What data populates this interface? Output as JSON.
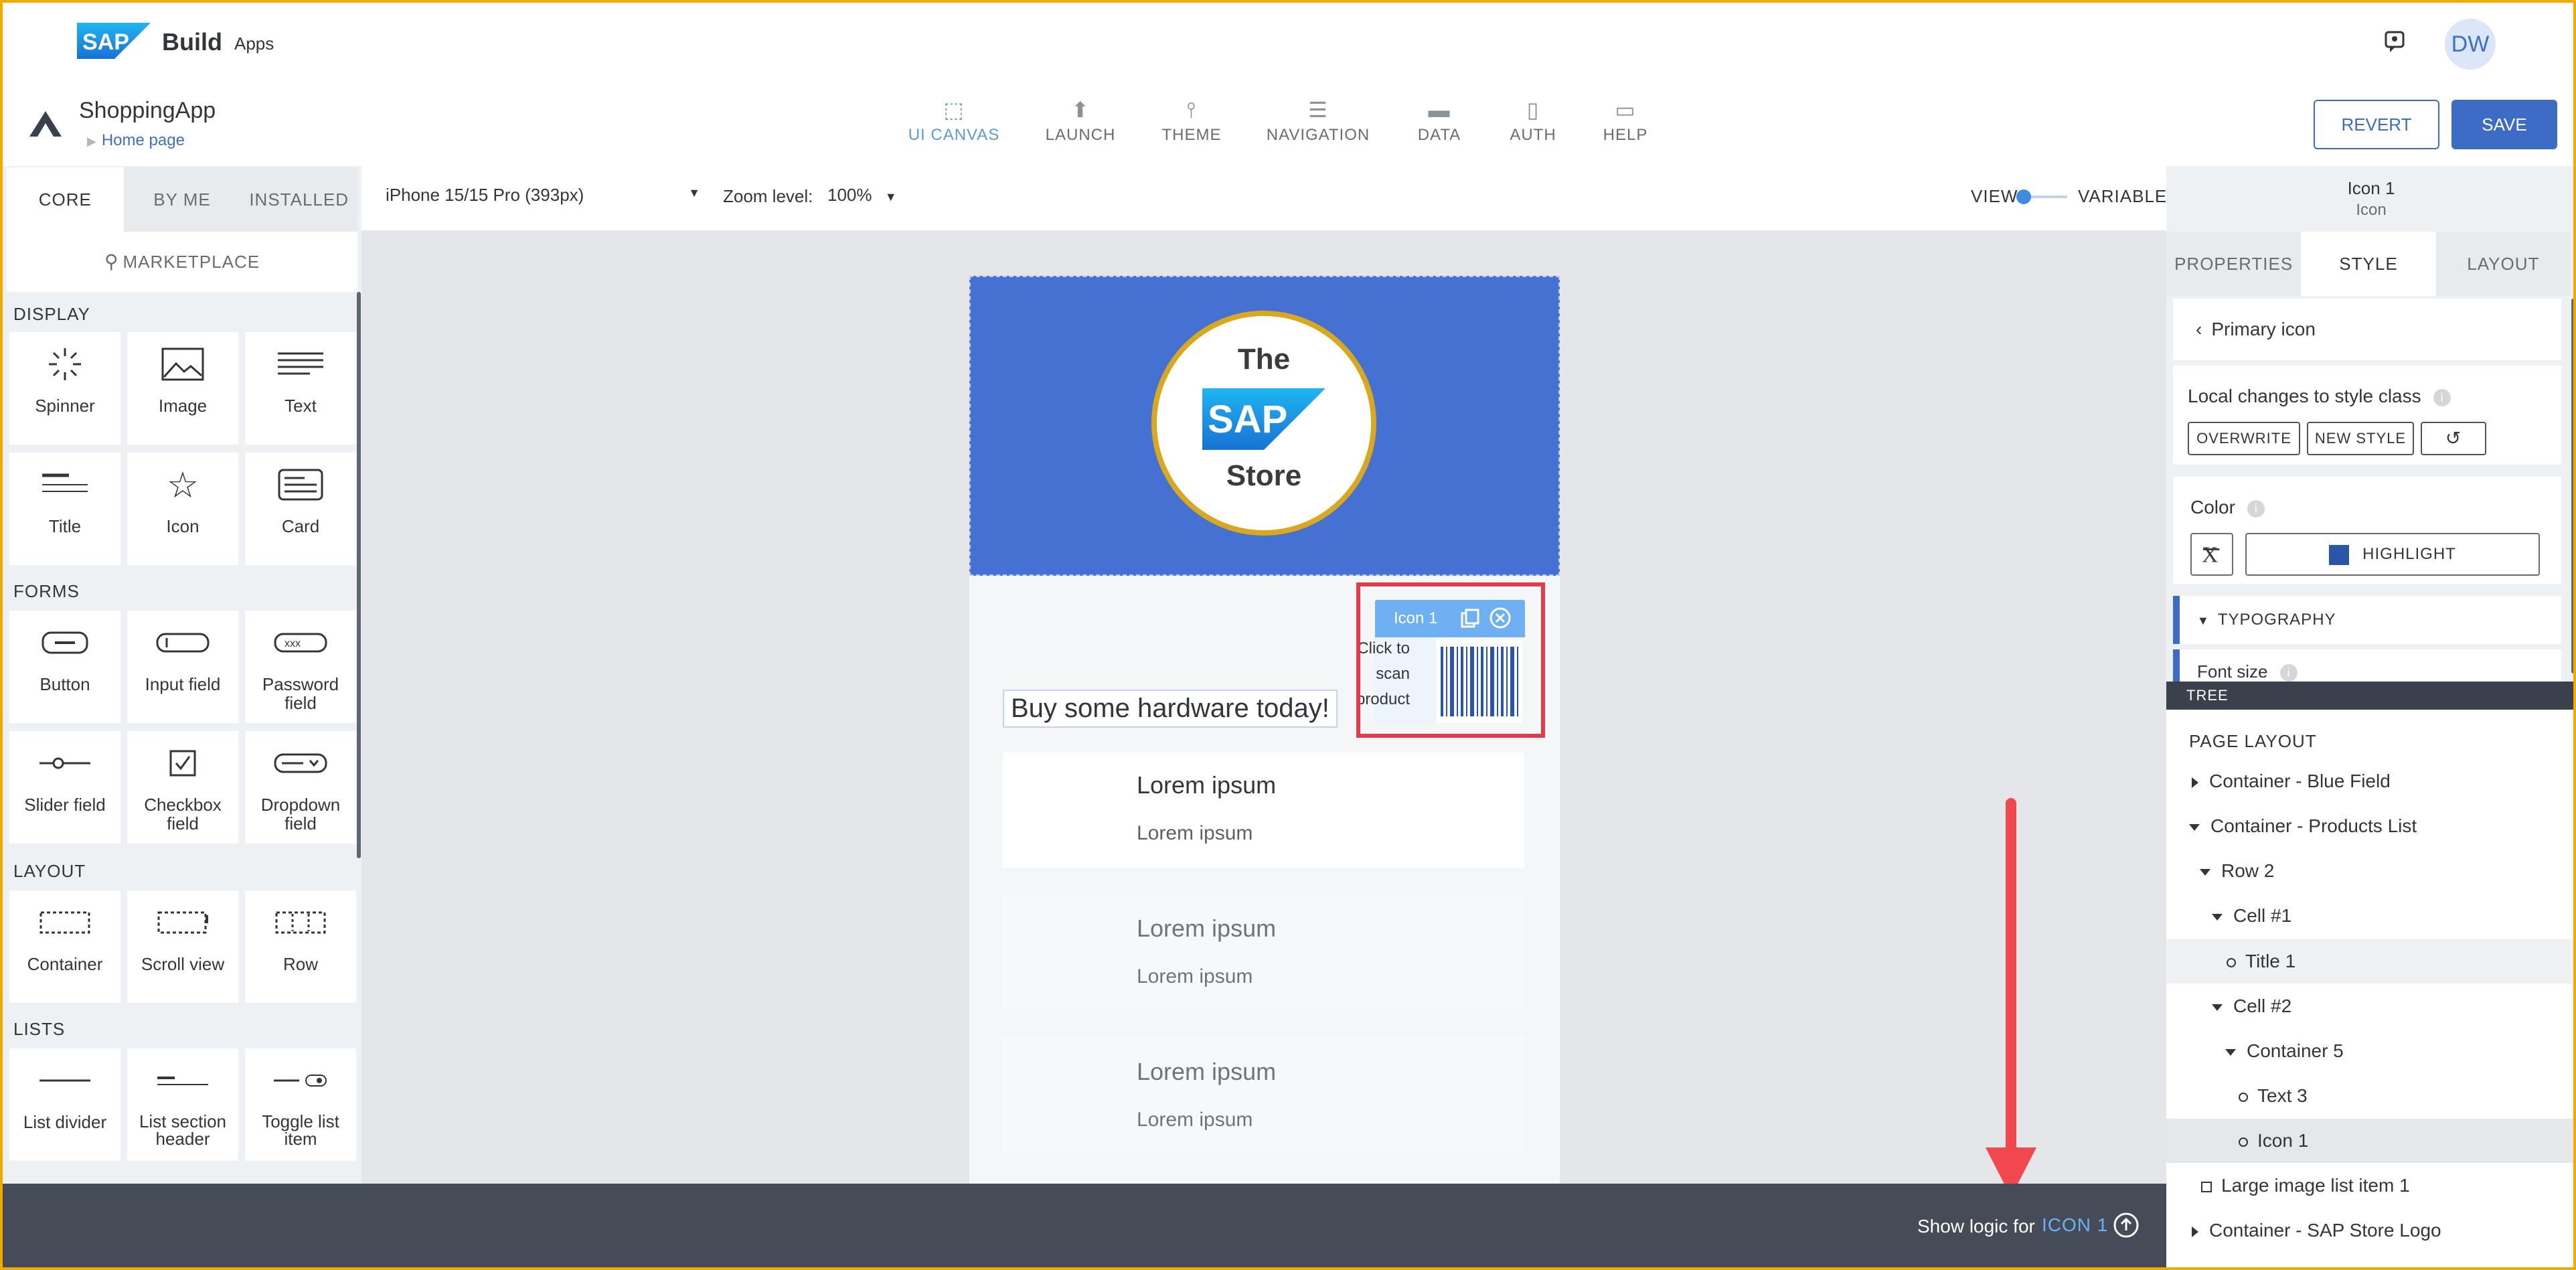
{
  "header": {
    "brand": "Build",
    "brand_sub": "Apps",
    "avatar_initials": "DW"
  },
  "app": {
    "name": "ShoppingApp",
    "breadcrumb": "Home page"
  },
  "nav_tabs": [
    {
      "label": "UI CANVAS",
      "icon": "ui-canvas-icon",
      "active": true
    },
    {
      "label": "LAUNCH",
      "icon": "launch-icon"
    },
    {
      "label": "THEME",
      "icon": "theme-brush-icon"
    },
    {
      "label": "NAVIGATION",
      "icon": "navigation-list-icon"
    },
    {
      "label": "DATA",
      "icon": "folder-icon"
    },
    {
      "label": "AUTH",
      "icon": "auth-document-icon"
    },
    {
      "label": "HELP",
      "icon": "help-chat-icon"
    }
  ],
  "actions": {
    "revert": "REVERT",
    "save": "SAVE"
  },
  "left_panel": {
    "tabs": [
      "CORE",
      "BY ME",
      "INSTALLED"
    ],
    "marketplace": "MARKETPLACE",
    "sections": {
      "display": "DISPLAY",
      "forms": "FORMS",
      "layout": "LAYOUT",
      "lists": "LISTS"
    },
    "display_items": [
      "Spinner",
      "Image",
      "Text",
      "Title",
      "Icon",
      "Card"
    ],
    "forms_items": [
      "Button",
      "Input field",
      "Password field",
      "Slider field",
      "Checkbox field",
      "Dropdown field"
    ],
    "layout_items": [
      "Container",
      "Scroll view",
      "Row"
    ],
    "lists_items": [
      "List divider",
      "List section header",
      "Toggle list item"
    ]
  },
  "toolbar": {
    "device": "iPhone 15/15 Pro (393px)",
    "zoom_label": "Zoom level:",
    "zoom_value": "100%",
    "view_label": "VIEW",
    "variables_label": "VARIABLES"
  },
  "canvas": {
    "logo_the": "The",
    "logo_sap": "SAP",
    "logo_store": "Store",
    "selected_badge": "Icon 1",
    "click_text": [
      "Click to",
      "scan",
      "product"
    ],
    "hardware_text": "Buy some hardware today!",
    "list_items": [
      {
        "title": "Lorem ipsum",
        "subtitle": "Lorem ipsum"
      },
      {
        "title": "Lorem ipsum",
        "subtitle": "Lorem ipsum"
      },
      {
        "title": "Lorem ipsum",
        "subtitle": "Lorem ipsum"
      }
    ]
  },
  "logic_bar": {
    "text": "Show logic for",
    "target": "ICON 1"
  },
  "right_panel": {
    "selected_title": "Icon 1",
    "selected_type": "Icon",
    "tabs": [
      "PROPERTIES",
      "STYLE",
      "LAYOUT"
    ],
    "style_class": "Primary icon",
    "local_changes": "Local changes to style class",
    "overwrite": "OVERWRITE",
    "new_style": "NEW STYLE",
    "color_label": "Color",
    "color_value": "HIGHLIGHT",
    "color_swatch": "#2a55a8",
    "typography": "TYPOGRAPHY",
    "font_size": "Font size",
    "tree_header": "TREE",
    "tree": [
      {
        "label": "PAGE LAYOUT",
        "marker": "none",
        "indent": 0
      },
      {
        "label": "Container - Blue Field",
        "marker": "collapsed",
        "indent": 1
      },
      {
        "label": "Container - Products List",
        "marker": "expanded",
        "indent": 1
      },
      {
        "label": "Row 2",
        "marker": "expanded",
        "indent": 2
      },
      {
        "label": "Cell #1",
        "marker": "expanded",
        "indent": 3
      },
      {
        "label": "Title 1",
        "marker": "dot",
        "indent": 4,
        "state": "hover"
      },
      {
        "label": "Cell #2",
        "marker": "expanded",
        "indent": 3
      },
      {
        "label": "Container 5",
        "marker": "expanded",
        "indent": 4
      },
      {
        "label": "Text 3",
        "marker": "dot",
        "indent": 5
      },
      {
        "label": "Icon 1",
        "marker": "dot",
        "indent": 5,
        "state": "selected"
      },
      {
        "label": "Large image list item 1",
        "marker": "square",
        "indent": 2
      },
      {
        "label": "Container - SAP Store Logo",
        "marker": "collapsed",
        "indent": 1
      }
    ]
  }
}
